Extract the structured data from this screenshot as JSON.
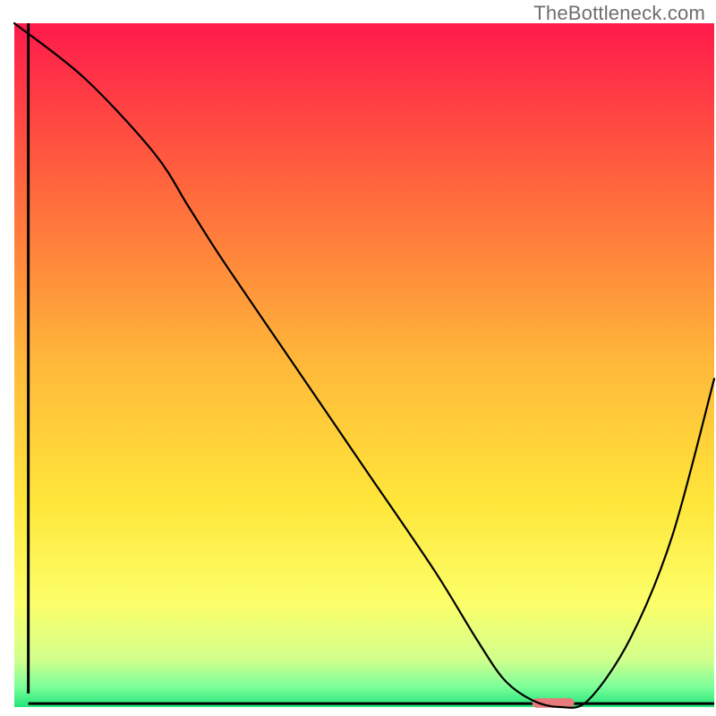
{
  "watermark": "TheBottleneck.com",
  "chart_data": {
    "type": "line",
    "title": "",
    "xlabel": "",
    "ylabel": "",
    "xlim": [
      0,
      100
    ],
    "ylim": [
      0,
      100
    ],
    "background": {
      "type": "vertical-gradient",
      "stops": [
        {
          "offset": 0.0,
          "color": "#ff1a4b"
        },
        {
          "offset": 0.25,
          "color": "#ff6a3c"
        },
        {
          "offset": 0.5,
          "color": "#ffb93a"
        },
        {
          "offset": 0.7,
          "color": "#ffe63a"
        },
        {
          "offset": 0.85,
          "color": "#fcff6a"
        },
        {
          "offset": 0.93,
          "color": "#d2ff8c"
        },
        {
          "offset": 0.97,
          "color": "#7dff9a"
        },
        {
          "offset": 1.0,
          "color": "#22e57a"
        }
      ]
    },
    "series": [
      {
        "name": "bottleneck-curve",
        "color": "#000000",
        "stroke_width": 2.2,
        "x": [
          0,
          10,
          20,
          25,
          30,
          40,
          50,
          60,
          66,
          70,
          74,
          78,
          82,
          88,
          94,
          100
        ],
        "y": [
          100,
          92,
          81,
          73,
          65,
          50,
          35,
          20,
          10,
          4,
          1,
          0,
          1,
          10,
          25,
          48
        ]
      }
    ],
    "marker": {
      "name": "optimal-point",
      "color": "#e77a7a",
      "x_start": 74,
      "x_end": 80,
      "y": 0.6,
      "height": 1.4
    },
    "axes": {
      "left": {
        "x": 2,
        "y0": 2,
        "y1": 100
      },
      "bottom": {
        "y": 0.5,
        "x0": 2,
        "x1": 100
      }
    }
  }
}
